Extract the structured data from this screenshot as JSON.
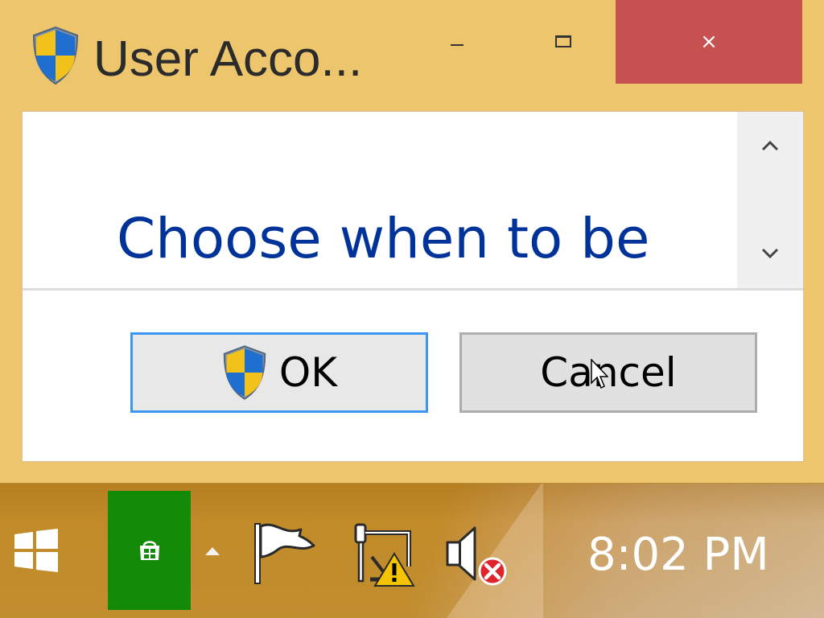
{
  "window": {
    "title": "User Acco...",
    "controls": {
      "minimize": "minimize",
      "maximize": "maximize",
      "close": "×"
    }
  },
  "message": {
    "text": "Choose when to be"
  },
  "buttons": {
    "ok_label": "OK",
    "cancel_label": "Cancel"
  },
  "taskbar": {
    "clock": "8:02 PM",
    "icons": [
      "windows-start-icon",
      "store-icon",
      "tray-arrow-icon",
      "flag-icon",
      "network-warning-icon",
      "volume-muted-icon"
    ]
  },
  "colors": {
    "title_bar": "#edc56c",
    "close_button": "#c75050",
    "message_text": "#003399",
    "ok_border": "#3c97f0",
    "store_tile": "#138a08"
  }
}
